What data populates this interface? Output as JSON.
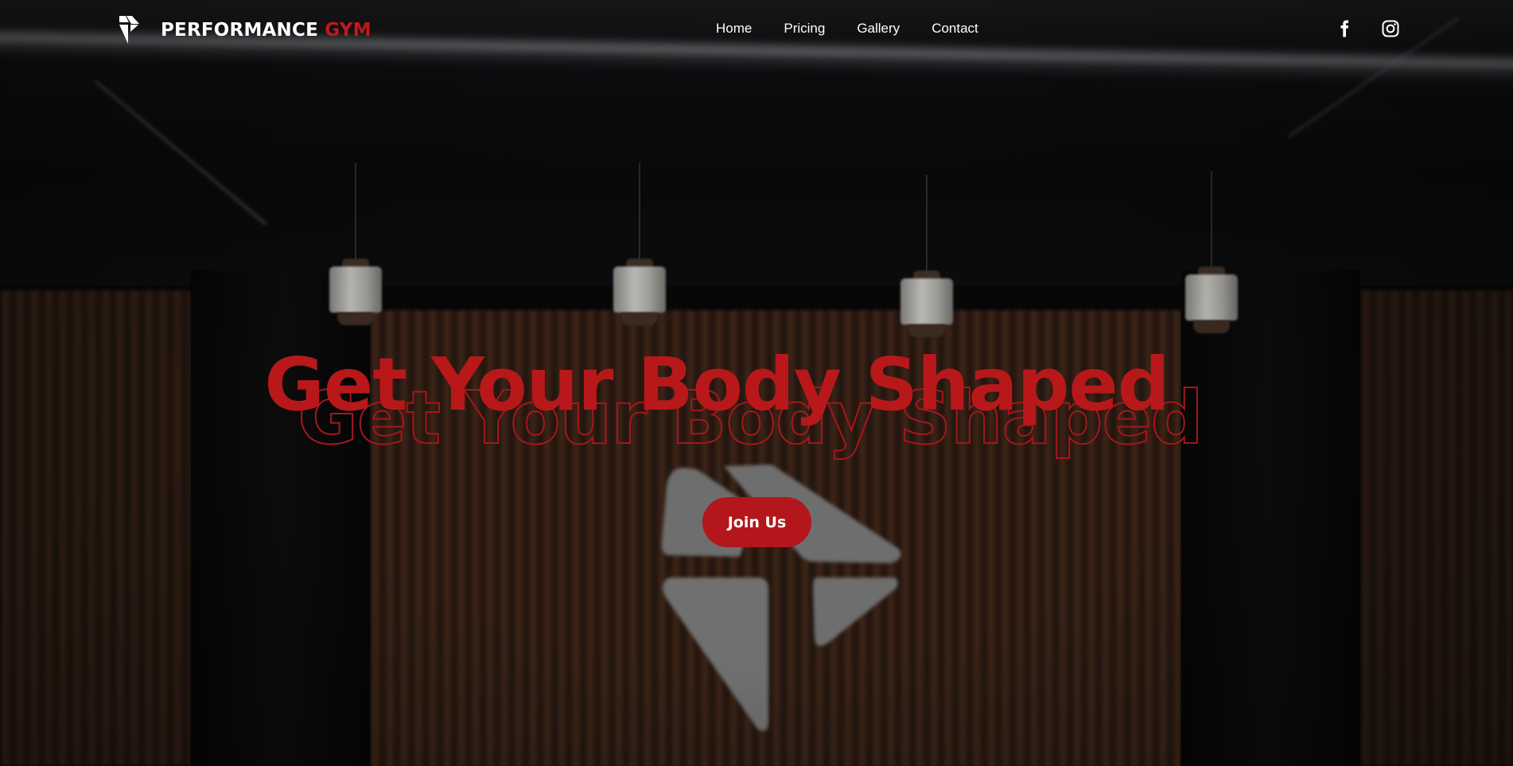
{
  "brand": {
    "name_primary": "PERFORMANCE",
    "name_accent": "GYM",
    "logo_icon": "brand-logo-icon"
  },
  "nav": {
    "items": [
      {
        "label": "Home"
      },
      {
        "label": "Pricing"
      },
      {
        "label": "Gallery"
      },
      {
        "label": "Contact"
      }
    ]
  },
  "social": {
    "items": [
      {
        "label": "Facebook",
        "icon": "facebook-icon"
      },
      {
        "label": "Instagram",
        "icon": "instagram-icon"
      }
    ]
  },
  "hero": {
    "headline": "Get Your Body Shaped",
    "cta_label": "Join Us"
  },
  "colors": {
    "accent": "#b8181a",
    "text": "#ffffff",
    "background": "#060607"
  }
}
